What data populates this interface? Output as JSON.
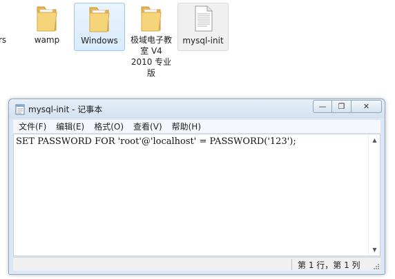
{
  "desktop": {
    "icons": [
      {
        "label": "rs"
      },
      {
        "label": "wamp"
      },
      {
        "label": "Windows"
      },
      {
        "label_lines": [
          "极域电子教",
          "室 V4",
          "2010 专业",
          "版"
        ]
      },
      {
        "label": "mysql-init"
      }
    ]
  },
  "window": {
    "title": "mysql-init - 记事本",
    "minimize_symbol": "—",
    "maximize_symbol": "❐",
    "close_symbol": "✕"
  },
  "menu": [
    "文件(F)",
    "编辑(E)",
    "格式(O)",
    "查看(V)",
    "帮助(H)"
  ],
  "editor": {
    "content": "SET PASSWORD FOR 'root'@'localhost' = PASSWORD('123');"
  },
  "statusbar": {
    "position": "第 1 行，第 1 列"
  },
  "colors": {
    "folder": "#f3cc6b",
    "selection": "#d9ebfb",
    "titlebar": "#dbe7f4"
  }
}
